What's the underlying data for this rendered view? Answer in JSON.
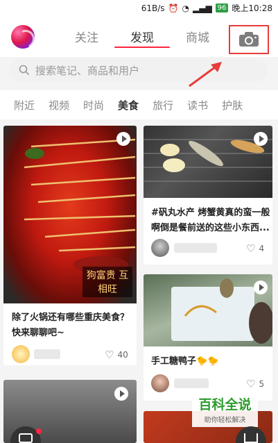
{
  "status_bar": {
    "speed": "61B/s",
    "battery": "96",
    "time": "晚上10:28"
  },
  "header": {
    "tabs": [
      {
        "label": "关注",
        "active": false
      },
      {
        "label": "发现",
        "active": true
      },
      {
        "label": "商城",
        "active": false
      }
    ]
  },
  "search": {
    "placeholder": "搜索笔记、商品和用户"
  },
  "categories": [
    "附近",
    "视频",
    "时尚",
    "美食",
    "旅行",
    "读书",
    "护肤"
  ],
  "active_category": "美食",
  "feed": [
    {
      "title": "除了火锅还有哪些重庆美食？快来聊聊吧~",
      "likes": "40",
      "image_caption": "狗富贵 互相旺"
    },
    {
      "title": "#矾丸水产 烤蟹黄真的蛮一般啊倒是餐前送的这些小东西...",
      "likes": "4"
    },
    {
      "title": "手工糖鸭子🐤🐤",
      "likes": "5"
    }
  ],
  "watermark": {
    "title": "百科全说",
    "subtitle": "助你轻松解决"
  },
  "colors": {
    "accent": "#ff2442",
    "highlight_box": "#e83b3b"
  }
}
